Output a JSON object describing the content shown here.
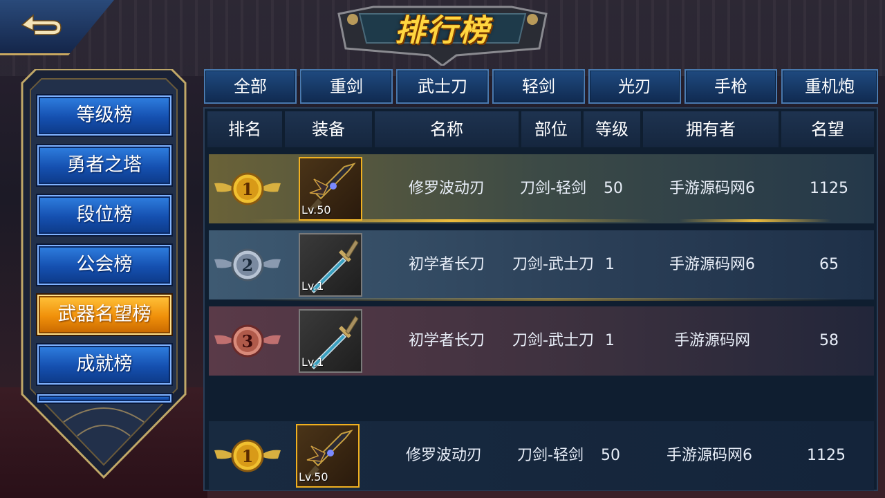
{
  "title": "排行榜",
  "colors": {
    "accent_gold": "#ffd640",
    "tab_blue": "#1f4a80",
    "active_orange": "#f0900a"
  },
  "icons": {
    "back": "back-arrow-icon",
    "weapon_rare": "dark-sword-icon",
    "weapon_common": "long-blade-icon"
  },
  "sidebar": {
    "items": [
      {
        "label": "等级榜",
        "active": false
      },
      {
        "label": "勇者之塔",
        "active": false
      },
      {
        "label": "段位榜",
        "active": false
      },
      {
        "label": "公会榜",
        "active": false
      },
      {
        "label": "武器名望榜",
        "active": true
      },
      {
        "label": "成就榜",
        "active": false
      }
    ]
  },
  "tabs": [
    "全部",
    "重剑",
    "武士刀",
    "轻剑",
    "光刃",
    "手枪",
    "重机炮"
  ],
  "table": {
    "headers": [
      "排名",
      "装备",
      "名称",
      "部位",
      "等级",
      "拥有者",
      "名望"
    ],
    "rows": [
      {
        "rank": "1",
        "level_tag": "Lv.50",
        "name": "修罗波动刃",
        "slot": "刀剑-轻剑",
        "level": "50",
        "owner": "手游源码网6",
        "fame": "1125"
      },
      {
        "rank": "2",
        "level_tag": "Lv.1",
        "name": "初学者长刀",
        "slot": "刀剑-武士刀",
        "level": "1",
        "owner": "手游源码网6",
        "fame": "65"
      },
      {
        "rank": "3",
        "level_tag": "Lv.1",
        "name": "初学者长刀",
        "slot": "刀剑-武士刀",
        "level": "1",
        "owner": "手游源码网",
        "fame": "58"
      }
    ],
    "my_row": {
      "rank": "1",
      "level_tag": "Lv.50",
      "name": "修罗波动刃",
      "slot": "刀剑-轻剑",
      "level": "50",
      "owner": "手游源码网6",
      "fame": "1125"
    }
  }
}
